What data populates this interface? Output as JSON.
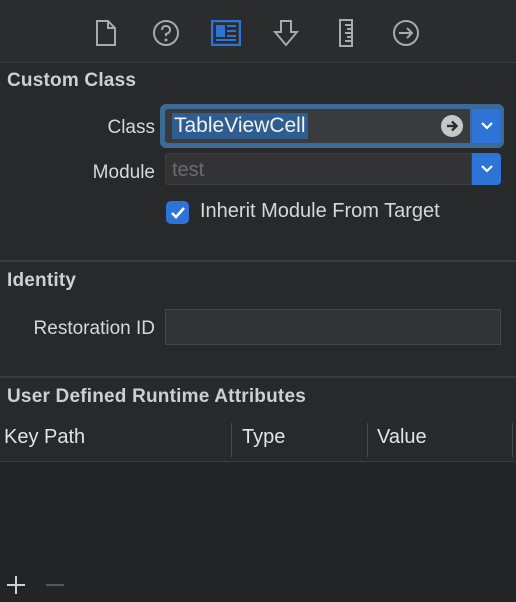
{
  "toolbar": {
    "icons": [
      {
        "name": "file-inspector-icon",
        "active": false
      },
      {
        "name": "quick-help-icon",
        "active": false
      },
      {
        "name": "identity-inspector-icon",
        "active": true
      },
      {
        "name": "attributes-inspector-icon",
        "active": false
      },
      {
        "name": "size-inspector-icon",
        "active": false
      },
      {
        "name": "connections-inspector-icon",
        "active": false
      }
    ]
  },
  "custom_class": {
    "title": "Custom Class",
    "class_label": "Class",
    "class_value": "TableViewCell",
    "module_label": "Module",
    "module_placeholder": "test",
    "inherit_label": "Inherit Module From Target",
    "inherit_checked": true
  },
  "identity": {
    "title": "Identity",
    "restoration_label": "Restoration ID",
    "restoration_value": ""
  },
  "runtime_attributes": {
    "title": "User Defined Runtime Attributes",
    "columns": [
      "Key Path",
      "Type",
      "Value"
    ],
    "rows": []
  },
  "colors": {
    "accent": "#2e74d6",
    "background": "#28292b",
    "text": "#dcdcdc"
  }
}
